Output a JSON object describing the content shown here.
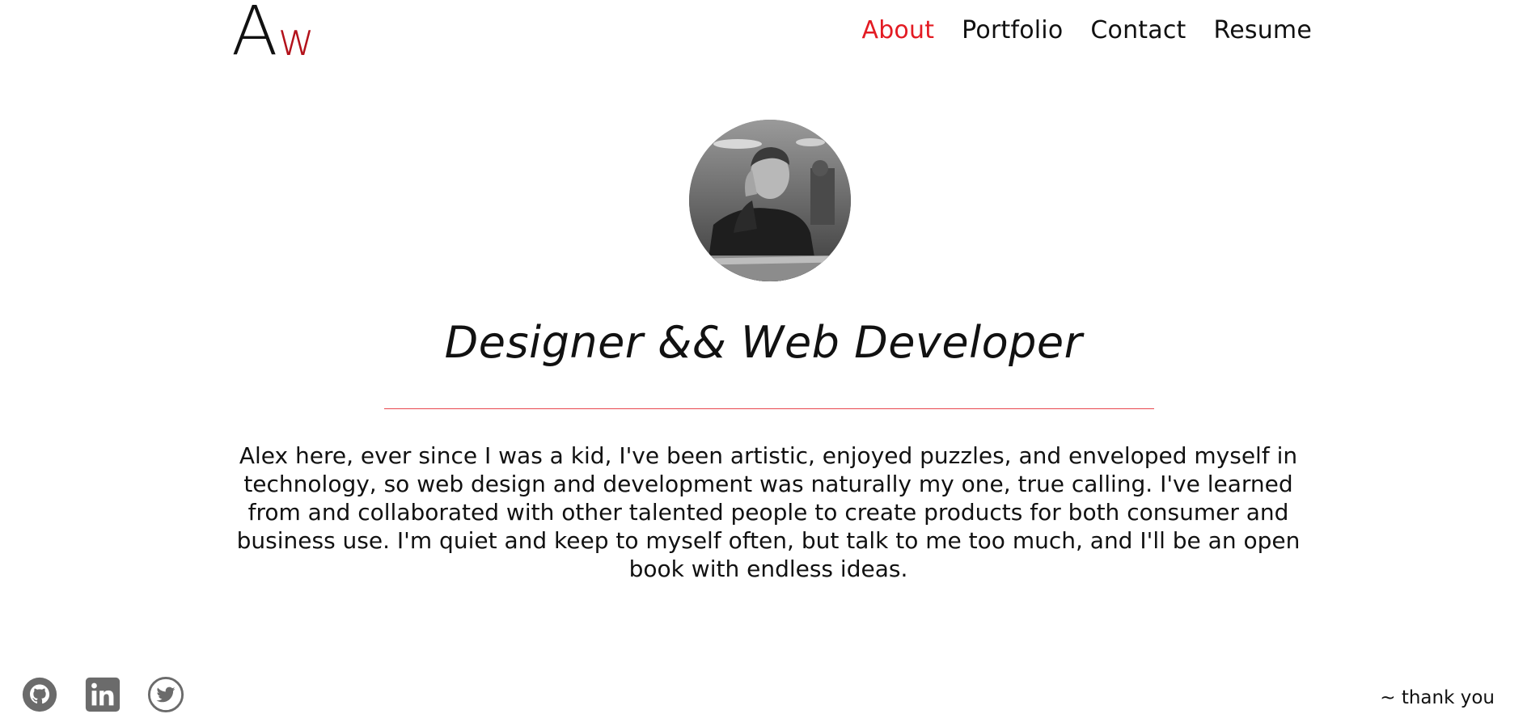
{
  "logo": {
    "first": "A",
    "second": "w"
  },
  "nav": {
    "items": [
      {
        "label": "About",
        "active": true
      },
      {
        "label": "Portfolio",
        "active": false
      },
      {
        "label": "Contact",
        "active": false
      },
      {
        "label": "Resume",
        "active": false
      }
    ]
  },
  "hero": {
    "headline": "Designer && Web Developer",
    "bio": "Alex here, ever since I was a kid, I've been artistic, enjoyed puzzles, and enveloped myself in technology, so web design and development was naturally my one, true calling. I've learned from and collaborated with other talented people to create products for both consumer and business use. I'm quiet and keep to myself often, but talk to me too much, and I'll be an open book with endless ideas."
  },
  "footer": {
    "social": [
      {
        "icon": "github-icon"
      },
      {
        "icon": "linkedin-icon"
      },
      {
        "icon": "twitter-icon"
      }
    ],
    "signoff": "~ thank you"
  },
  "colors": {
    "accent": "#e31b23",
    "logo_accent": "#b3121b",
    "icon_gray": "#6b6b6b",
    "divider": "#e8474f"
  }
}
